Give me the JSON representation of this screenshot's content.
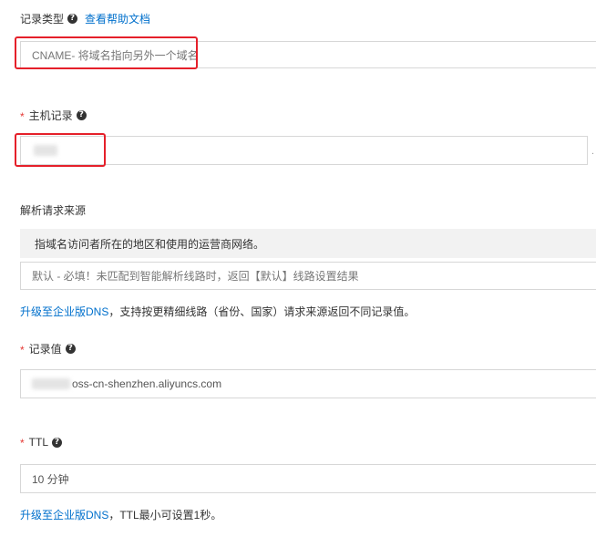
{
  "record_type": {
    "label": "记录类型",
    "help_icon": "question-circle-icon",
    "help_link": "查看帮助文档",
    "value": "CNAME- 将域名指向另外一个域名"
  },
  "host_record": {
    "required_mark": "*",
    "label": "主机记录",
    "help_icon": "question-circle-icon",
    "suffix": "."
  },
  "resolution_source": {
    "label": "解析请求来源",
    "description": "指域名访问者所在的地区和使用的运营商网络。",
    "placeholder": "默认 - 必填！未匹配到智能解析线路时，返回【默认】线路设置结果",
    "upgrade_link": "升级至企业版DNS",
    "upgrade_text": "，支持按更精细线路（省份、国家）请求来源返回不同记录值。"
  },
  "record_value": {
    "required_mark": "*",
    "label": "记录值",
    "help_icon": "question-circle-icon",
    "value_suffix": "oss-cn-shenzhen.aliyuncs.com"
  },
  "ttl": {
    "required_mark": "*",
    "label": "TTL",
    "help_icon": "question-circle-icon",
    "value": "10 分钟",
    "upgrade_link": "升级至企业版DNS",
    "upgrade_text": "，TTL最小可设置1秒。"
  },
  "colors": {
    "link": "#0070cc",
    "required": "#e53935",
    "highlight_border": "#e5202a",
    "input_border": "#d7d7d7",
    "info_background": "#f2f2f2"
  }
}
